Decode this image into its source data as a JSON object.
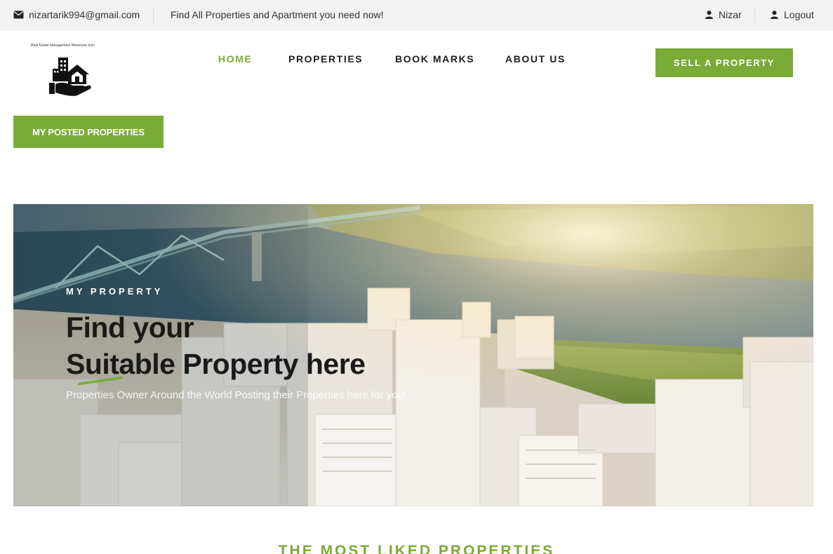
{
  "topbar": {
    "email": "nizartarik994@gmail.com",
    "tagline": "Find All Properties and Apartment you need now!",
    "user": "Nizar",
    "logout": "Logout"
  },
  "logo": {
    "caption": "Real Estate Management Monotone Icon"
  },
  "nav": {
    "items": [
      {
        "label": "HOME",
        "active": true
      },
      {
        "label": "PROPERTIES",
        "active": false
      },
      {
        "label": "BOOK MARKS",
        "active": false
      },
      {
        "label": "ABOUT US",
        "active": false
      }
    ]
  },
  "buttons": {
    "sell": "SELL A PROPERTY",
    "posted": "MY POSTED PROPERTIES"
  },
  "hero": {
    "eyebrow": "MY PROPERTY",
    "headline_line1": "Find your",
    "headline_line2": "Suitable Property here",
    "subtitle": "Properties Owner Around the World Posting their Properties here for you!"
  },
  "section": {
    "title": "THE MOST LIKED PROPERTIES"
  },
  "colors": {
    "accent": "#7aab36",
    "topbar_bg": "#f2f2f2",
    "text_dark": "#1e1e1e"
  },
  "icons": {
    "email": "envelope-icon",
    "user": "user-icon",
    "logout": "user-icon"
  }
}
